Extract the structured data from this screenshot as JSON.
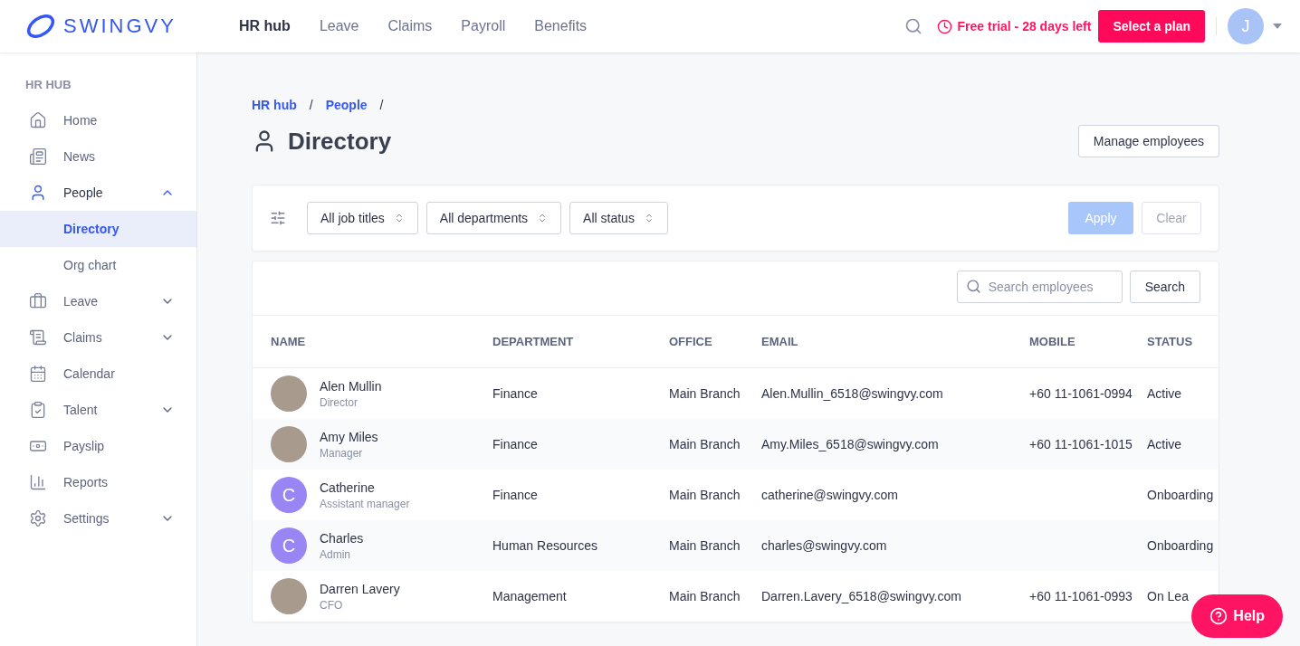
{
  "brand": {
    "name": "SWINGVY"
  },
  "top_nav": [
    {
      "label": "HR hub",
      "selected": true
    },
    {
      "label": "Leave",
      "selected": false
    },
    {
      "label": "Claims",
      "selected": false
    },
    {
      "label": "Payroll",
      "selected": false
    },
    {
      "label": "Benefits",
      "selected": false
    }
  ],
  "trial": {
    "text": "Free trial - 28 days left"
  },
  "plan_button": "Select a plan",
  "user": {
    "initial": "J"
  },
  "sidebar": {
    "heading": "HR HUB",
    "items": [
      {
        "label": "Home",
        "selected": false
      },
      {
        "label": "News",
        "selected": false
      },
      {
        "label": "People",
        "selected": true,
        "expanded": true,
        "children": [
          {
            "label": "Directory",
            "selected": true
          },
          {
            "label": "Org chart",
            "selected": false
          }
        ]
      },
      {
        "label": "Leave",
        "selected": false,
        "expanded": false
      },
      {
        "label": "Claims",
        "selected": false,
        "expanded": false
      },
      {
        "label": "Calendar",
        "selected": false
      },
      {
        "label": "Talent",
        "selected": false,
        "expanded": false
      },
      {
        "label": "Payslip",
        "selected": false
      },
      {
        "label": "Reports",
        "selected": false
      },
      {
        "label": "Settings",
        "selected": false,
        "expanded": false
      }
    ]
  },
  "breadcrumb": [
    {
      "kind": "link",
      "label": "HR hub"
    },
    {
      "kind": "separator",
      "label": "/"
    },
    {
      "kind": "link",
      "label": "People"
    },
    {
      "kind": "separator",
      "label": "/"
    }
  ],
  "page_title": "Directory",
  "manage_button": "Manage employees",
  "filters": [
    "All job titles",
    "All departments",
    "All status"
  ],
  "apply_button": {
    "label": "Apply",
    "disabled": true
  },
  "clear_button": {
    "label": "Clear",
    "disabled": true
  },
  "search": {
    "placeholder": "Search employees",
    "button": "Search"
  },
  "table": {
    "columns": [
      "NAME",
      "DEPARTMENT",
      "OFFICE",
      "EMAIL",
      "MOBILE",
      "STATUS"
    ],
    "rows": [
      {
        "name": "Alen Mullin",
        "role": "Director",
        "avatar": {
          "kind": "photo"
        },
        "department": "Finance",
        "office": "Main Branch",
        "email": "Alen.Mullin_6518@swingvy.com",
        "mobile": "+60 11-1061-0994",
        "status": "Active"
      },
      {
        "name": "Amy Miles",
        "role": "Manager",
        "avatar": {
          "kind": "photo"
        },
        "department": "Finance",
        "office": "Main Branch",
        "email": "Amy.Miles_6518@swingvy.com",
        "mobile": "+60 11-1061-1015",
        "status": "Active"
      },
      {
        "name": "Catherine",
        "role": "Assistant manager",
        "avatar": {
          "kind": "initial",
          "text": "C"
        },
        "department": "Finance",
        "office": "Main Branch",
        "email": "catherine@swingvy.com",
        "status": "Onboarding"
      },
      {
        "name": "Charles",
        "role": "Admin",
        "avatar": {
          "kind": "initial",
          "text": "C"
        },
        "department": "Human Resources",
        "office": "Main Branch",
        "email": "charles@swingvy.com",
        "status": "Onboarding"
      },
      {
        "name": "Darren Lavery",
        "role": "CFO",
        "avatar": {
          "kind": "photo"
        },
        "department": "Management",
        "office": "Main Branch",
        "email": "Darren.Lavery_6518@swingvy.com",
        "mobile": "+60 11-1061-0993",
        "status": "On Lea"
      }
    ]
  },
  "help_button": "Help"
}
